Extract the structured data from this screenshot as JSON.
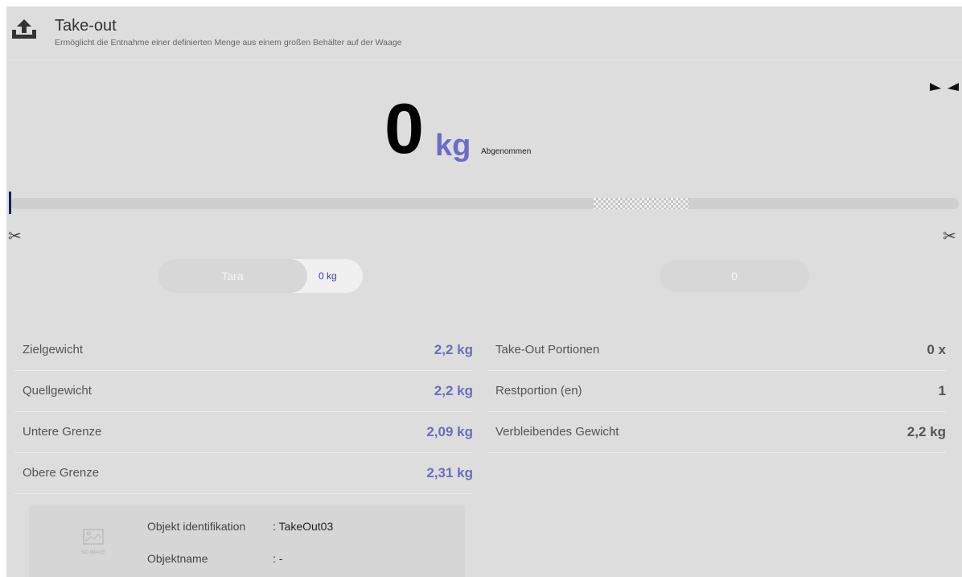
{
  "header": {
    "title": "Take-out",
    "subtitle": "Ermöglicht die Entnahme einer definierten Menge aus einem großen Behälter auf der Waage",
    "icon": "take-out-upload-icon"
  },
  "colors": {
    "accent": "#6c6cc2",
    "marker": "#10245c",
    "panel_bg": "#dddddd"
  },
  "reading": {
    "value": "0",
    "unit": "kg",
    "status": "Abgenommen"
  },
  "progress": {
    "current_fraction": 0.0,
    "target_start_fraction": 0.615,
    "target_end_fraction": 0.715
  },
  "controls": {
    "tara_label": "Tara",
    "tara_value": "0 kg",
    "counter_value": "0"
  },
  "left_rows": [
    {
      "label": "Zielgewicht",
      "value": "2,2 kg"
    },
    {
      "label": "Quellgewicht",
      "value": "2,2 kg"
    },
    {
      "label": "Untere Grenze",
      "value": "2,09 kg"
    },
    {
      "label": "Obere Grenze",
      "value": "2,31 kg"
    }
  ],
  "right_rows": [
    {
      "label": "Take-Out Portionen",
      "value": "0 x"
    },
    {
      "label": "Restportion (en)",
      "value": "1"
    },
    {
      "label": "Verbleibendes Gewicht",
      "value": "2,2 kg"
    }
  ],
  "object": {
    "no_image_text": "NO IMAGE",
    "id_label": "Objekt identifikation",
    "id_value": ": TakeOut03",
    "name_label": "Objektname",
    "name_value": ": -"
  }
}
